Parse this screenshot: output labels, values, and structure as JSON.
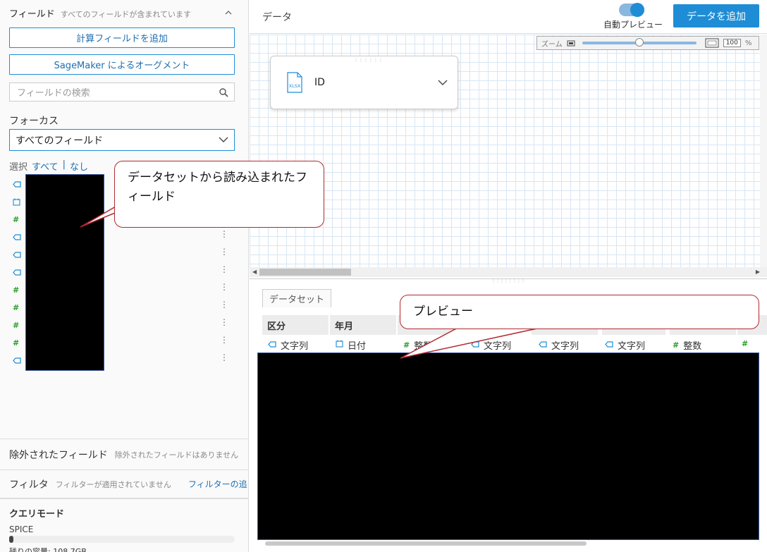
{
  "fields_panel": {
    "title": "フィールド",
    "subtitle": "すべてのフィールドが含まれています",
    "add_calc_label": "計算フィールドを追加",
    "sagemaker_label": "SageMaker によるオーグメント",
    "search_placeholder": "フィールドの検索",
    "focus_label": "フォーカス",
    "focus_value": "すべてのフィールド",
    "select_label": "選択",
    "select_all": "すべて",
    "select_sep": "|",
    "select_none": "なし",
    "field_types": [
      "text",
      "date",
      "number",
      "text",
      "text",
      "text",
      "number",
      "number",
      "number",
      "number",
      "text"
    ]
  },
  "excluded": {
    "title": "除外されたフィールド",
    "subtitle": "除外されたフィールドはありません"
  },
  "filter": {
    "title": "フィルタ",
    "subtitle": "フィルターが適用されていません",
    "link": "フィルターの追"
  },
  "query": {
    "title": "クエリモード",
    "mode": "SPICE",
    "capacity_label": "残りの容量: 108.7GB",
    "capacity_fill": 0.02
  },
  "header": {
    "title": "データ",
    "auto_preview": "自動プレビュー",
    "add_data": "データを追加",
    "auto_preview_on": true
  },
  "zoom": {
    "label": "ズーム",
    "value": "100",
    "unit": "%",
    "level": 0.5
  },
  "dataset_card": {
    "name": "ID",
    "file_type": "XLSX"
  },
  "preview": {
    "tab": "データセット",
    "columns": [
      "区分",
      "年月"
    ],
    "types": [
      {
        "icon": "text",
        "label": "文字列"
      },
      {
        "icon": "date",
        "label": "日付"
      },
      {
        "icon": "number",
        "label": "整数"
      },
      {
        "icon": "text",
        "label": "文字列"
      },
      {
        "icon": "text",
        "label": "文字列"
      },
      {
        "icon": "text",
        "label": "文字列"
      },
      {
        "icon": "number",
        "label": "整数"
      },
      {
        "icon": "number",
        "label": ""
      }
    ]
  },
  "callouts": {
    "fields": "データセットから読み込まれたフィールド",
    "preview": "プレビュー"
  },
  "colors": {
    "accent": "#1f8dd6",
    "number": "#2a9d2a",
    "callout_border": "#b02a30"
  }
}
